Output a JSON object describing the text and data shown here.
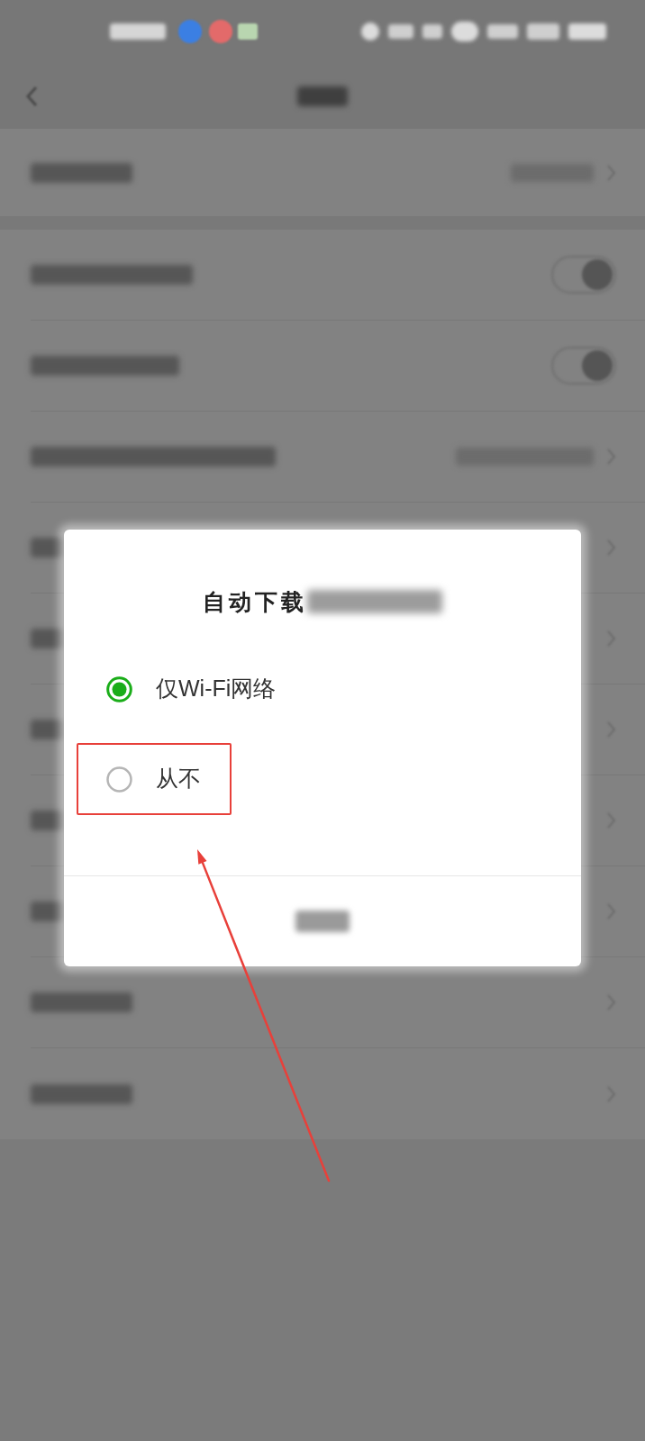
{
  "settings": {
    "sections": [
      {
        "rows": [
          {
            "kind": "value"
          }
        ]
      },
      {
        "rows": [
          {
            "kind": "toggle",
            "on": true
          },
          {
            "kind": "toggle",
            "on": true
          },
          {
            "kind": "value"
          },
          {
            "kind": "link"
          },
          {
            "kind": "link"
          },
          {
            "kind": "link"
          },
          {
            "kind": "link"
          },
          {
            "kind": "link"
          },
          {
            "kind": "link"
          },
          {
            "kind": "link"
          }
        ]
      }
    ]
  },
  "dialog": {
    "title": "自动下载",
    "options": [
      {
        "label": "仅Wi-Fi网络",
        "selected": true,
        "highlighted": false
      },
      {
        "label": "从不",
        "selected": false,
        "highlighted": true
      }
    ]
  }
}
